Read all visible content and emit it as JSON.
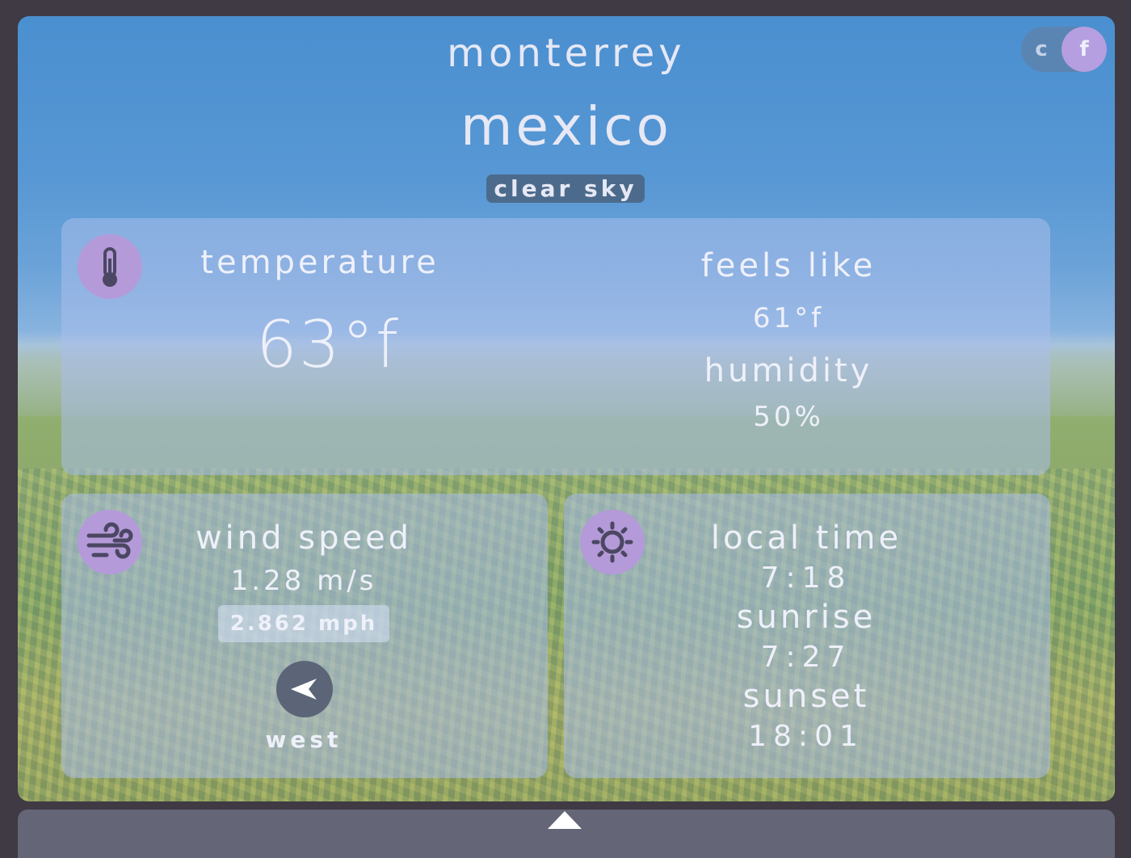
{
  "location": {
    "city": "monterrey",
    "country": "mexico",
    "description": "clear sky"
  },
  "unit_toggle": {
    "c_label": "c",
    "f_label": "f",
    "selected": "f"
  },
  "temperature_card": {
    "temperature_label": "temperature",
    "temperature_value": "63°f",
    "feels_like_label": "feels like",
    "feels_like_value": "61°f",
    "humidity_label": "humidity",
    "humidity_value": "50%",
    "icon": "thermometer-icon"
  },
  "wind_card": {
    "label": "wind speed",
    "speed_ms": "1.28 m/s",
    "speed_mph": "2.862 mph",
    "direction": "west",
    "icon": "wind-icon",
    "direction_icon": "arrow-left-icon"
  },
  "time_card": {
    "local_time_label": "local time",
    "local_time_value": "7:18",
    "sunrise_label": "sunrise",
    "sunrise_value": "7:27",
    "sunset_label": "sunset",
    "sunset_value": "18:01",
    "icon": "sun-icon"
  },
  "colors": {
    "accent": "#b59ad9",
    "badge": "#4c6b8c",
    "text": "#eef0fa"
  }
}
